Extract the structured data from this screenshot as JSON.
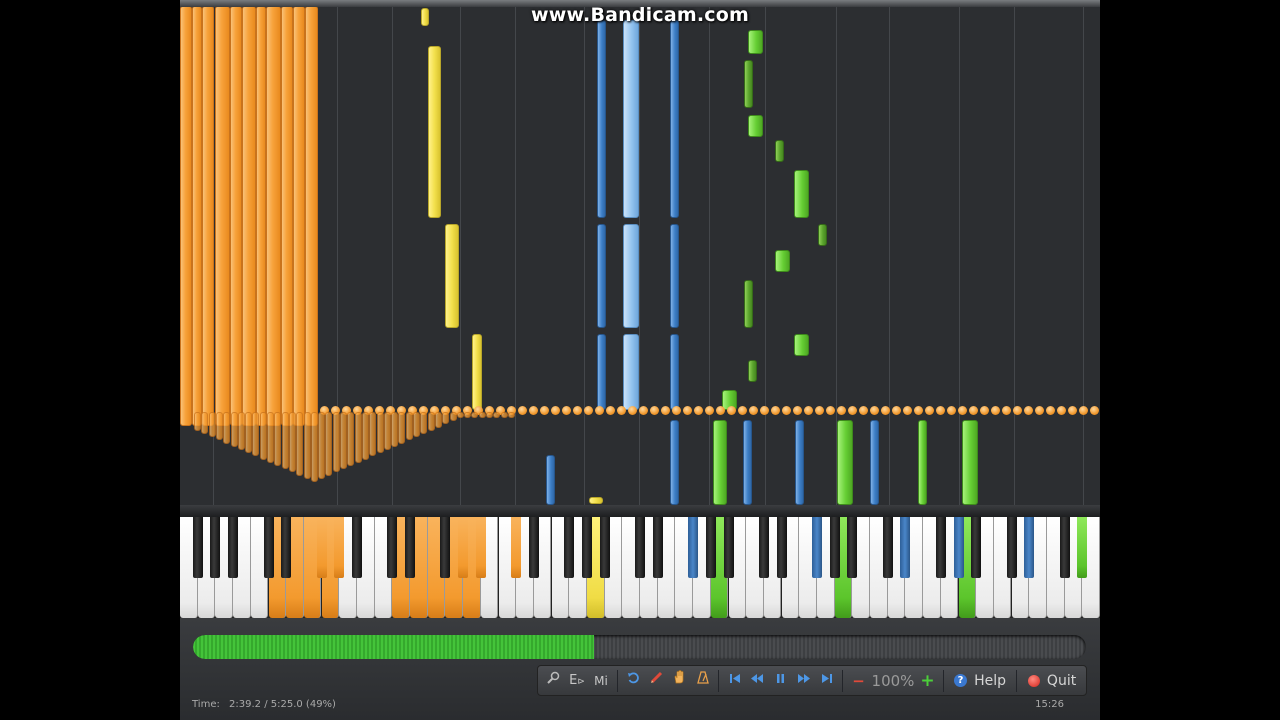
{
  "watermark": "www.Bandicam.com",
  "toolbar": {
    "edit_label": "E",
    "midi_label": "Mi",
    "zoom_value": "100%",
    "zoom_minus": "−",
    "zoom_plus": "+",
    "help_label": "Help",
    "quit_label": "Quit"
  },
  "icons": [
    "zoom-icon",
    "loop-icon",
    "pencil-icon",
    "hand-icon",
    "metronome-icon",
    "skip-start-icon",
    "rewind-icon",
    "pause-icon",
    "fast-forward-icon",
    "skip-end-icon",
    "help-icon",
    "quit-icon"
  ],
  "status": {
    "time_label": "Time:",
    "time_value": "2:39.2 / 5:25.0 (49%)",
    "clock": "15:26"
  },
  "progress": {
    "fraction": 0.49
  },
  "colors": {
    "orange_track": "#f39a2e",
    "yellow_track": "#f0dc45",
    "blue_track": "#3d7fc7",
    "light_blue_track": "#93c3ef",
    "green_track": "#66cf34",
    "progress_green": "#44c43a",
    "background": "#2c2e31"
  }
}
